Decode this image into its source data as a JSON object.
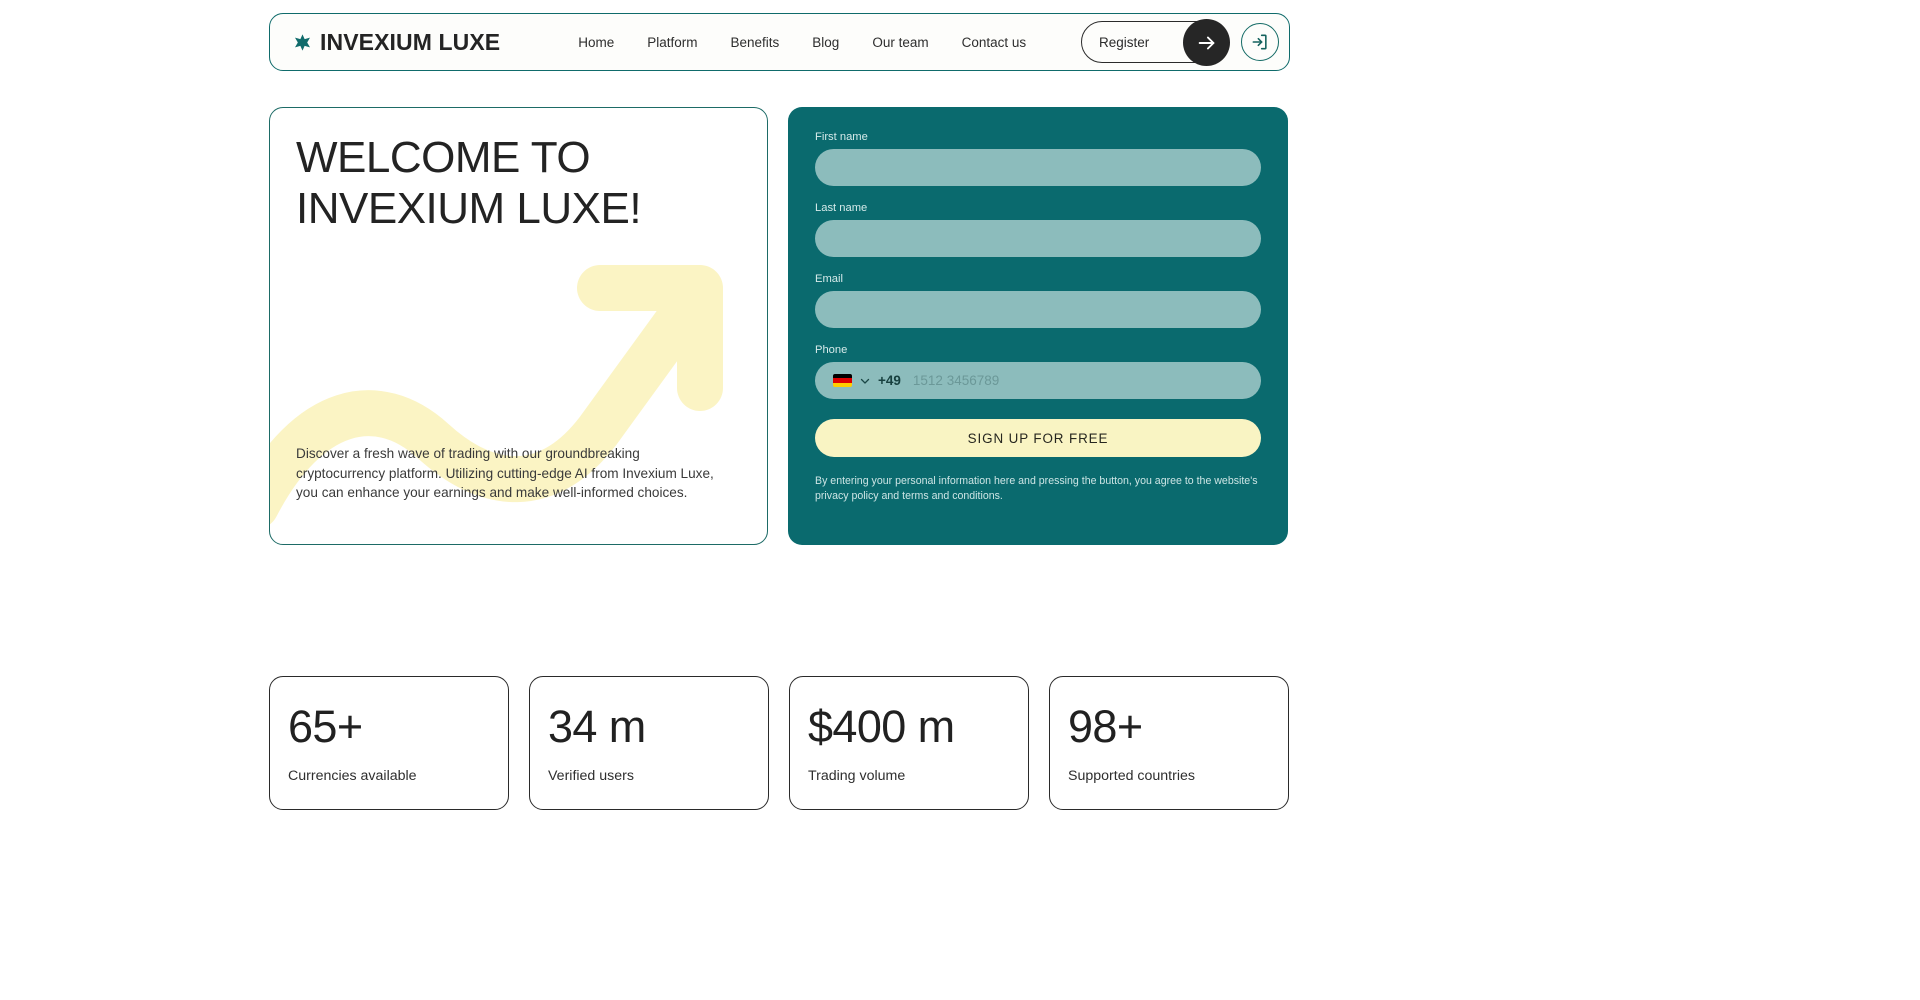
{
  "theme": {
    "teal": "#0a6a6e",
    "teal_border": "#1d6b66",
    "input_fill": "#8cbcbc",
    "yellow": "#f9f4c3",
    "dark": "#262626",
    "page_bg": "#ffffff"
  },
  "header": {
    "logo_icon": "six-point-star-icon",
    "brand": "INVEXIUM LUXE",
    "nav": [
      {
        "label": "Home"
      },
      {
        "label": "Platform"
      },
      {
        "label": "Benefits"
      },
      {
        "label": "Blog"
      },
      {
        "label": "Our team"
      },
      {
        "label": "Contact us"
      }
    ],
    "register_label": "Register",
    "register_arrow_icon": "arrow-right-icon",
    "login_icon": "login-enter-icon"
  },
  "hero": {
    "title": "WELCOME TO INVEXIUM LUXE!",
    "description": "Discover a fresh wave of trading with our groundbreaking cryptocurrency platform. Utilizing cutting-edge AI from Invexium Luxe, you can enhance your earnings and make well-informed choices.",
    "decoration_icon": "wavy-arrow-up-right-icon"
  },
  "form": {
    "fields": [
      {
        "label": "First name",
        "value": "",
        "placeholder": ""
      },
      {
        "label": "Last name",
        "value": "",
        "placeholder": ""
      },
      {
        "label": "Email",
        "value": "",
        "placeholder": ""
      }
    ],
    "phone": {
      "label": "Phone",
      "flag_icon": "flag-germany-icon",
      "chevron_icon": "chevron-down-icon",
      "dial_code": "+49",
      "placeholder": "1512 3456789",
      "value": ""
    },
    "submit_label": "SIGN UP FOR FREE",
    "disclaimer": "By entering your personal information here and pressing the button, you agree to the website's privacy policy and terms and conditions."
  },
  "stats": [
    {
      "value": "65+",
      "label": "Currencies available"
    },
    {
      "value": "34 m",
      "label": "Verified users"
    },
    {
      "value": "$400 m",
      "label": "Trading volume"
    },
    {
      "value": "98+",
      "label": "Supported countries"
    }
  ]
}
